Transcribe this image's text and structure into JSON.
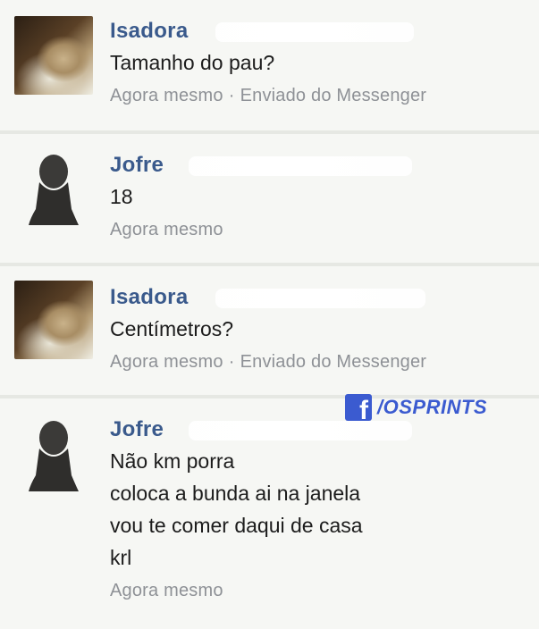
{
  "messages": [
    {
      "sender": "Isadora",
      "text": [
        "Tamanho do pau?"
      ],
      "time": "Agora mesmo",
      "via": "Enviado do Messenger"
    },
    {
      "sender": "Jofre",
      "text": [
        "18"
      ],
      "time": "Agora mesmo"
    },
    {
      "sender": "Isadora",
      "text": [
        "Centímetros?"
      ],
      "time": "Agora mesmo",
      "via": "Enviado do Messenger"
    },
    {
      "sender": "Jofre",
      "text": [
        "Não km porra",
        "coloca a bunda ai na janela",
        "vou te comer daqui de casa",
        "krl"
      ],
      "time": "Agora mesmo"
    }
  ],
  "separator": "·",
  "watermark": {
    "icon": "facebook-icon",
    "icon_glyph": "f",
    "text": "/OSPRINTS",
    "color": "#3b5bd0"
  },
  "colors": {
    "name": "#3a5a8c",
    "meta": "#8e9196",
    "background": "#f6f7f4"
  }
}
